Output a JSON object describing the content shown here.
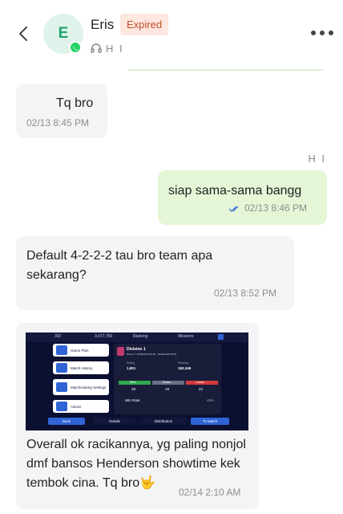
{
  "header": {
    "avatar_letter": "E",
    "contact_name": "Eris",
    "status_badge": "Expired",
    "agent_initials": "H I"
  },
  "messages": [
    {
      "text": "Tq bro",
      "time": "02/13 8:45 PM"
    },
    {
      "sender": "H I",
      "text": "siap sama-sama bangg",
      "time": "02/13 8:46 PM"
    },
    {
      "text": "Default 4-2-2-2 tau bro team apa sekarang?",
      "time": "02/13 8:52 PM"
    },
    {
      "text": "Overall ok racikannya, yg paling nonjol dmf bansos Henderson showtime kek tembok cina. Tq bro🤟",
      "time": "02/14 2:10 AM"
    }
  ],
  "game_screenshot": {
    "coins": "392",
    "gp": "3,477,760",
    "tab_ranking": "Ranking",
    "tab_missions": "Missions",
    "menu": [
      "Game Plan",
      "Match History",
      "Matchmaking Settings",
      "Advice"
    ],
    "division": "Division 1",
    "phase": "Phase 7: 05/02/2026 09:00 - 05/03/2026 08:59",
    "rating_label": "Rating",
    "rating_value": "1,801",
    "ranking_label": "Ranking",
    "ranking_value": "183,346",
    "wins_label": "Wins",
    "wins_value": "39",
    "draws_label": "Draws",
    "draws_value": "19",
    "losses_label": "Losses",
    "losses_value": "22",
    "win_rate_label": "Win Rate",
    "win_rate_value": "49%",
    "back_label": "Back",
    "details_label": "Details",
    "distribution_label": "Distribution",
    "to_match_label": "To Match"
  },
  "colors": {
    "whatsapp_green": "#25d366",
    "badge_bg": "#fde7df",
    "badge_text": "#c24e2b",
    "outgoing_bubble": "#e4f6d6",
    "incoming_bubble": "#f3f4f6",
    "read_ticks": "#4a7bd8"
  }
}
